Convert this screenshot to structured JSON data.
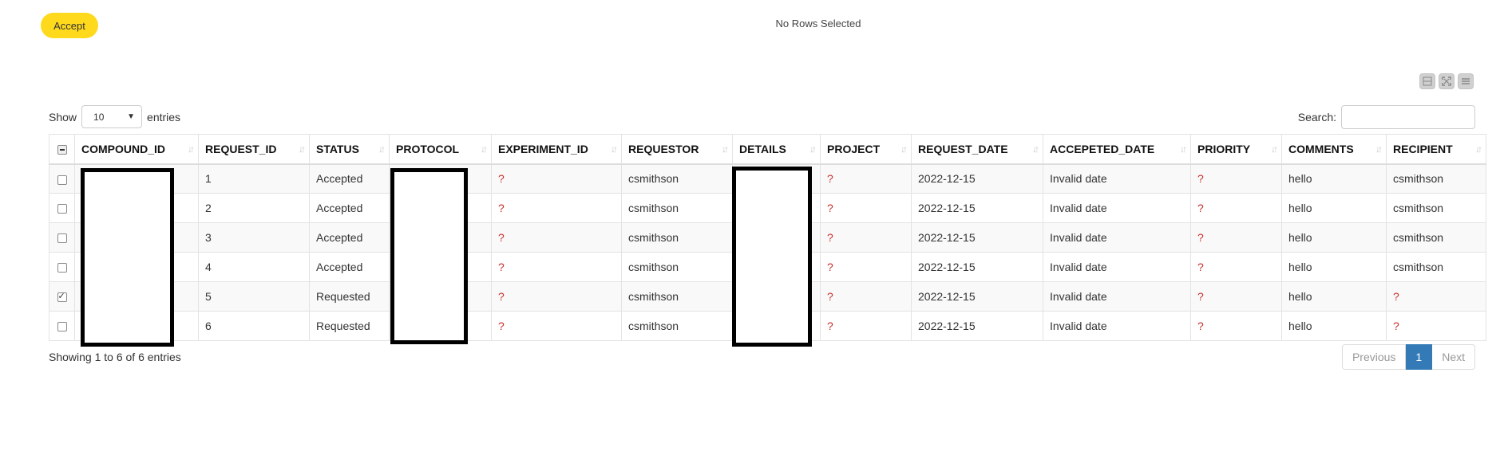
{
  "toolbar": {
    "accept_label": "Accept",
    "selection_status": "No Rows Selected"
  },
  "icons": {
    "column_tools": [
      "collapse-icon",
      "fullscreen-icon",
      "list-icon"
    ]
  },
  "length": {
    "show_label": "Show",
    "selected_value": "10",
    "entries_label": "entries"
  },
  "search": {
    "label": "Search:",
    "value": ""
  },
  "table": {
    "columns": [
      "COMPOUND_ID",
      "REQUEST_ID",
      "STATUS",
      "PROTOCOL",
      "EXPERIMENT_ID",
      "REQUESTOR",
      "DETAILS",
      "PROJECT",
      "REQUEST_DATE",
      "ACCEPETED_DATE",
      "PRIORITY",
      "COMMENTS",
      "RECIPIENT"
    ],
    "rows": [
      {
        "checked": false,
        "cells": [
          "",
          "1",
          "Accepted",
          "",
          "?",
          "csmithson",
          "",
          "?",
          "2022-12-15",
          "Invalid date",
          "?",
          "hello",
          "csmithson"
        ]
      },
      {
        "checked": false,
        "cells": [
          "",
          "2",
          "Accepted",
          "",
          "?",
          "csmithson",
          "",
          "?",
          "2022-12-15",
          "Invalid date",
          "?",
          "hello",
          "csmithson"
        ]
      },
      {
        "checked": false,
        "cells": [
          "",
          "3",
          "Accepted",
          "",
          "?",
          "csmithson",
          "",
          "?",
          "2022-12-15",
          "Invalid date",
          "?",
          "hello",
          "csmithson"
        ]
      },
      {
        "checked": false,
        "cells": [
          "",
          "4",
          "Accepted",
          "",
          "?",
          "csmithson",
          "",
          "?",
          "2022-12-15",
          "Invalid date",
          "?",
          "hello",
          "csmithson"
        ]
      },
      {
        "checked": true,
        "cells": [
          "",
          "5",
          "Requested",
          "",
          "?",
          "csmithson",
          "",
          "?",
          "2022-12-15",
          "Invalid date",
          "?",
          "hello",
          "?"
        ]
      },
      {
        "checked": false,
        "cells": [
          "",
          "6",
          "Requested",
          "",
          "?",
          "csmithson",
          "",
          "?",
          "2022-12-15",
          "Invalid date",
          "?",
          "hello",
          "?"
        ]
      }
    ]
  },
  "footer": {
    "info": "Showing 1 to 6 of 6 entries",
    "previous_label": "Previous",
    "current_page": "1",
    "next_label": "Next"
  },
  "colors": {
    "accept_button": "#ffd91c",
    "missing_value": "#c9302c",
    "active_page": "#337ab7"
  }
}
